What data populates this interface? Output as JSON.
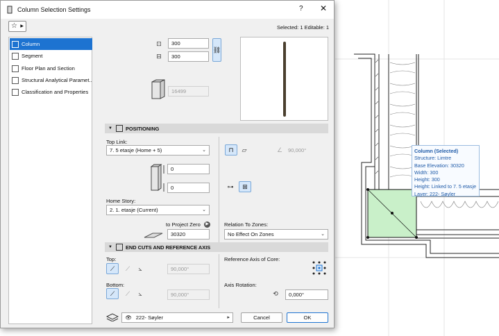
{
  "dialog": {
    "title": "Column Selection Settings",
    "help_glyph": "?",
    "close_glyph": "✕",
    "favorites_glyph": "☆",
    "selected_info": "Selected: 1 Editable: 1"
  },
  "nav": {
    "items": [
      {
        "label": "Column",
        "active": true
      },
      {
        "label": "Segment",
        "active": false
      },
      {
        "label": "Floor Plan and Section",
        "active": false
      },
      {
        "label": "Structural Analytical Paramet...",
        "active": false
      },
      {
        "label": "Classification and Properties",
        "active": false
      }
    ]
  },
  "size": {
    "width": "300",
    "depth": "300",
    "height": "16499"
  },
  "positioning": {
    "title": "POSITIONING",
    "top_link_label": "Top Link:",
    "top_link_value": "7. 5 etasje (Home + 5)",
    "top_offset": "0",
    "bottom_offset": "0",
    "home_story_label": "Home Story:",
    "home_story_value": "2. 1. etasje (Current)",
    "to_project_zero_label": "to Project Zero",
    "to_project_zero_value": "30320",
    "slant_angle": "90,000°",
    "relation_label": "Relation To Zones:",
    "relation_value": "No Effect On Zones"
  },
  "end_cuts": {
    "title": "END CUTS AND REFERENCE AXIS",
    "top_label": "Top:",
    "top_angle": "90,000°",
    "bottom_label": "Bottom:",
    "bottom_angle": "90,000°",
    "reference_axis_label": "Reference Axis of Core:",
    "axis_rotation_label": "Axis Rotation:",
    "axis_rotation_value": "0,000°"
  },
  "footer": {
    "layer_value": "222- Søyler",
    "cancel_label": "Cancel",
    "ok_label": "OK"
  },
  "tooltip": {
    "title": "Column (Selected)",
    "lines": [
      "Structure: Limtre",
      "Base Elevation: 30320",
      "Width: 300",
      "Height: 300",
      "Height: Linked to 7. 5 etasje",
      "Layer: 222- Søyler"
    ]
  },
  "colors": {
    "accent": "#1d73d1",
    "column_fill": "#c9f0c9",
    "tooltip_text": "#1e5aa8"
  }
}
